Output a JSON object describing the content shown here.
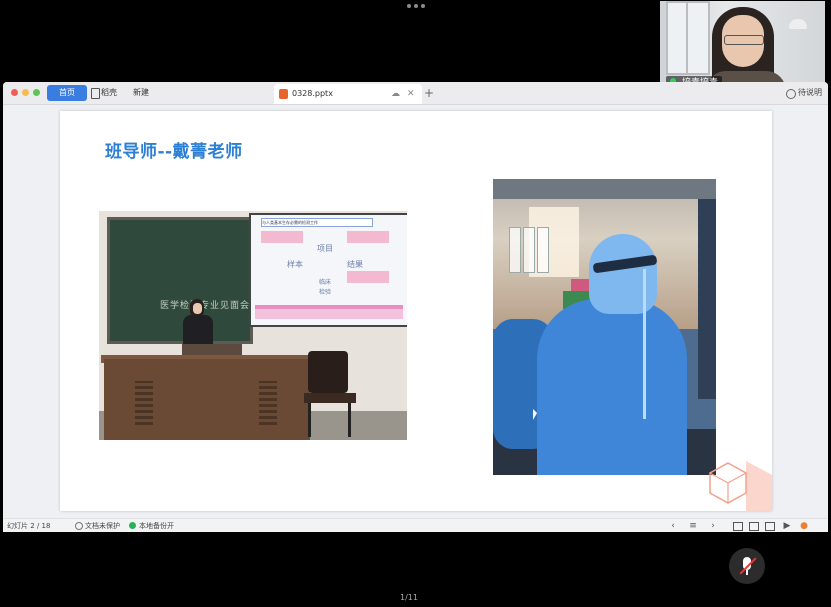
{
  "webcam": {
    "participant_name": "培青培青"
  },
  "tabs": {
    "home": "首页",
    "draft": "稻壳",
    "new": "新建",
    "file": "0328.pptx",
    "add": "+"
  },
  "header": {
    "sign_button": "待说明"
  },
  "slide": {
    "title": "班导师--戴菁老师",
    "photo1_board_text": "医学检验专业见面会",
    "photo1_screen": {
      "header": "与人类基本生存必需的检测工作",
      "w1": "项目",
      "w2": "样本",
      "w3": "结果",
      "w4": "临床",
      "w5": "检验"
    }
  },
  "statusbar": {
    "page": "幻灯片 2 / 18",
    "protect": "文档未保护",
    "backup": "本地备份开",
    "icons": [
      "prev-icon",
      "menu-icon",
      "next-icon",
      "normal-view-icon",
      "slide-sorter-icon",
      "reading-view-icon",
      "play-icon",
      "orange-dot-icon"
    ]
  },
  "bottom": {
    "page_indicator": "1/11"
  },
  "colors": {
    "accent": "#3a7de0",
    "title": "#2b7fd6",
    "ppt": "#e8642c",
    "deco": "#f4a08a"
  }
}
